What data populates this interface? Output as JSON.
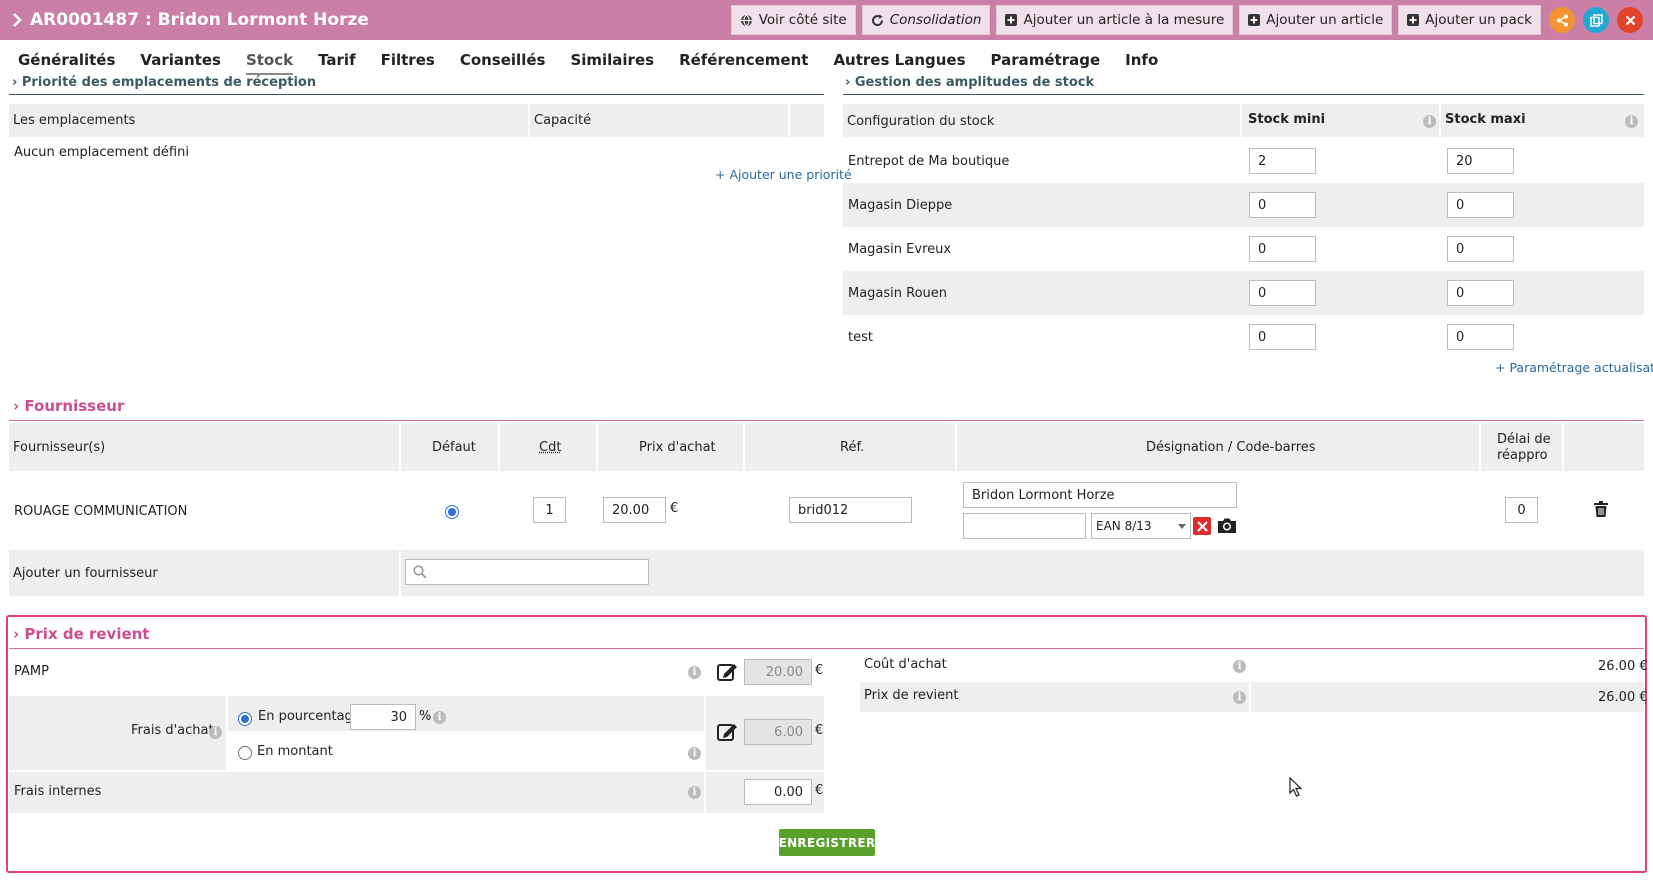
{
  "header": {
    "title": "AR0001487 : Bridon Lormont Horze",
    "buttons": [
      "Voir côté site",
      "Consolidation",
      "Ajouter un article à la mesure",
      "Ajouter un article",
      "Ajouter un pack"
    ],
    "icon_buttons": [
      "share-icon",
      "copy-icon",
      "close-icon"
    ]
  },
  "tabs": [
    "Généralités",
    "Variantes",
    "Stock",
    "Tarif",
    "Filtres",
    "Conseillés",
    "Similaires",
    "Référencement",
    "Autres Langues",
    "Paramétrage",
    "Info"
  ],
  "active_tab": "Stock",
  "reception": {
    "title": "Priorité des emplacements de réception",
    "col_emplacements": "Les emplacements",
    "col_capacite": "Capacité",
    "empty": "Aucun emplacement défini",
    "add_link": "+ Ajouter une priorité"
  },
  "amplitudes": {
    "title": "Gestion des amplitudes de stock",
    "col_config": "Configuration du stock",
    "col_mini": "Stock mini",
    "col_maxi": "Stock maxi",
    "rows": [
      {
        "name": "Entrepot de Ma boutique",
        "mini": "2",
        "maxi": "20"
      },
      {
        "name": "Magasin Dieppe",
        "mini": "0",
        "maxi": "0"
      },
      {
        "name": "Magasin Evreux",
        "mini": "0",
        "maxi": "0"
      },
      {
        "name": "Magasin Rouen",
        "mini": "0",
        "maxi": "0"
      },
      {
        "name": "test",
        "mini": "0",
        "maxi": "0"
      }
    ],
    "link": "+ Paramétrage actualisation"
  },
  "fournisseur": {
    "title": "Fournisseur",
    "cols": {
      "fournisseurs": "Fournisseur(s)",
      "defaut": "Défaut",
      "cdt": "Cdt",
      "prix": "Prix d'achat",
      "ref": "Réf.",
      "designation": "Désignation / Code-barres",
      "delai1": "Délai de",
      "delai2": "réappro"
    },
    "row": {
      "name": "ROUAGE COMMUNICATION",
      "cdt": "1",
      "prix": "20.00",
      "currency": "€",
      "ref": "brid012",
      "designation": "Bridon Lormont Horze",
      "barcode": "",
      "barcode_type": "EAN 8/13",
      "delai": "0"
    },
    "add_label": "Ajouter un fournisseur",
    "search_placeholder": ""
  },
  "prix": {
    "title": "Prix de revient",
    "pamp_label": "PAMP",
    "pamp_value": "20.00",
    "frais_label": "Frais d'achats",
    "opt_pct": "En pourcentage",
    "pct_value": "30",
    "pct_symbol": "%",
    "opt_montant": "En montant",
    "frais_value": "6.00",
    "internes_label": "Frais internes",
    "internes_value": "0.00",
    "currency": "€",
    "cout_label": "Coût d'achat",
    "cout_value": "26.00 €",
    "revient_label": "Prix de revient",
    "revient_value": "26.00 €"
  },
  "save_label": "ENREGISTRER"
}
